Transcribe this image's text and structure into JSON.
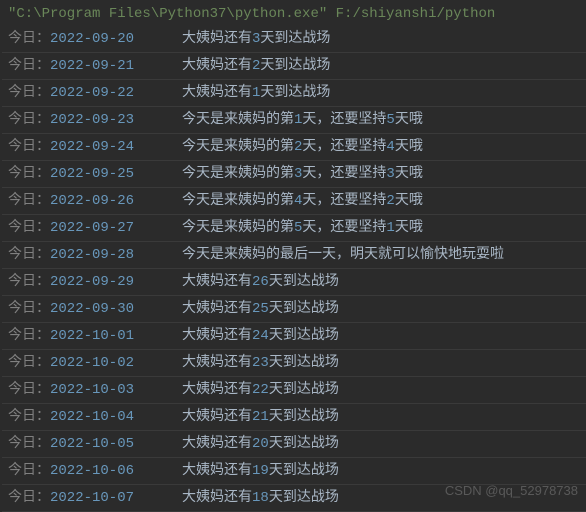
{
  "command_line": "\"C:\\Program Files\\Python37\\python.exe\" F:/shiyanshi/python",
  "label_prefix": "今日：",
  "watermark": "CSDN @qq_52978738",
  "rows": [
    {
      "date": "2022-09-20",
      "msg_parts": [
        "大姨妈还有",
        "3",
        "天到达战场"
      ]
    },
    {
      "date": "2022-09-21",
      "msg_parts": [
        "大姨妈还有",
        "2",
        "天到达战场"
      ]
    },
    {
      "date": "2022-09-22",
      "msg_parts": [
        "大姨妈还有",
        "1",
        "天到达战场"
      ]
    },
    {
      "date": "2022-09-23",
      "msg_parts": [
        "今天是来姨妈的第",
        "1",
        "天，还要坚持",
        "5",
        "天哦"
      ]
    },
    {
      "date": "2022-09-24",
      "msg_parts": [
        "今天是来姨妈的第",
        "2",
        "天，还要坚持",
        "4",
        "天哦"
      ]
    },
    {
      "date": "2022-09-25",
      "msg_parts": [
        "今天是来姨妈的第",
        "3",
        "天，还要坚持",
        "3",
        "天哦"
      ]
    },
    {
      "date": "2022-09-26",
      "msg_parts": [
        "今天是来姨妈的第",
        "4",
        "天，还要坚持",
        "2",
        "天哦"
      ]
    },
    {
      "date": "2022-09-27",
      "msg_parts": [
        "今天是来姨妈的第",
        "5",
        "天，还要坚持",
        "1",
        "天哦"
      ]
    },
    {
      "date": "2022-09-28",
      "msg_parts": [
        "今天是来姨妈的最后一天，明天就可以愉快地玩耍啦"
      ]
    },
    {
      "date": "2022-09-29",
      "msg_parts": [
        "大姨妈还有",
        "26",
        "天到达战场"
      ]
    },
    {
      "date": "2022-09-30",
      "msg_parts": [
        "大姨妈还有",
        "25",
        "天到达战场"
      ]
    },
    {
      "date": "2022-10-01",
      "msg_parts": [
        "大姨妈还有",
        "24",
        "天到达战场"
      ]
    },
    {
      "date": "2022-10-02",
      "msg_parts": [
        "大姨妈还有",
        "23",
        "天到达战场"
      ]
    },
    {
      "date": "2022-10-03",
      "msg_parts": [
        "大姨妈还有",
        "22",
        "天到达战场"
      ]
    },
    {
      "date": "2022-10-04",
      "msg_parts": [
        "大姨妈还有",
        "21",
        "天到达战场"
      ]
    },
    {
      "date": "2022-10-05",
      "msg_parts": [
        "大姨妈还有",
        "20",
        "天到达战场"
      ]
    },
    {
      "date": "2022-10-06",
      "msg_parts": [
        "大姨妈还有",
        "19",
        "天到达战场"
      ]
    },
    {
      "date": "2022-10-07",
      "msg_parts": [
        "大姨妈还有",
        "18",
        "天到达战场"
      ]
    }
  ]
}
